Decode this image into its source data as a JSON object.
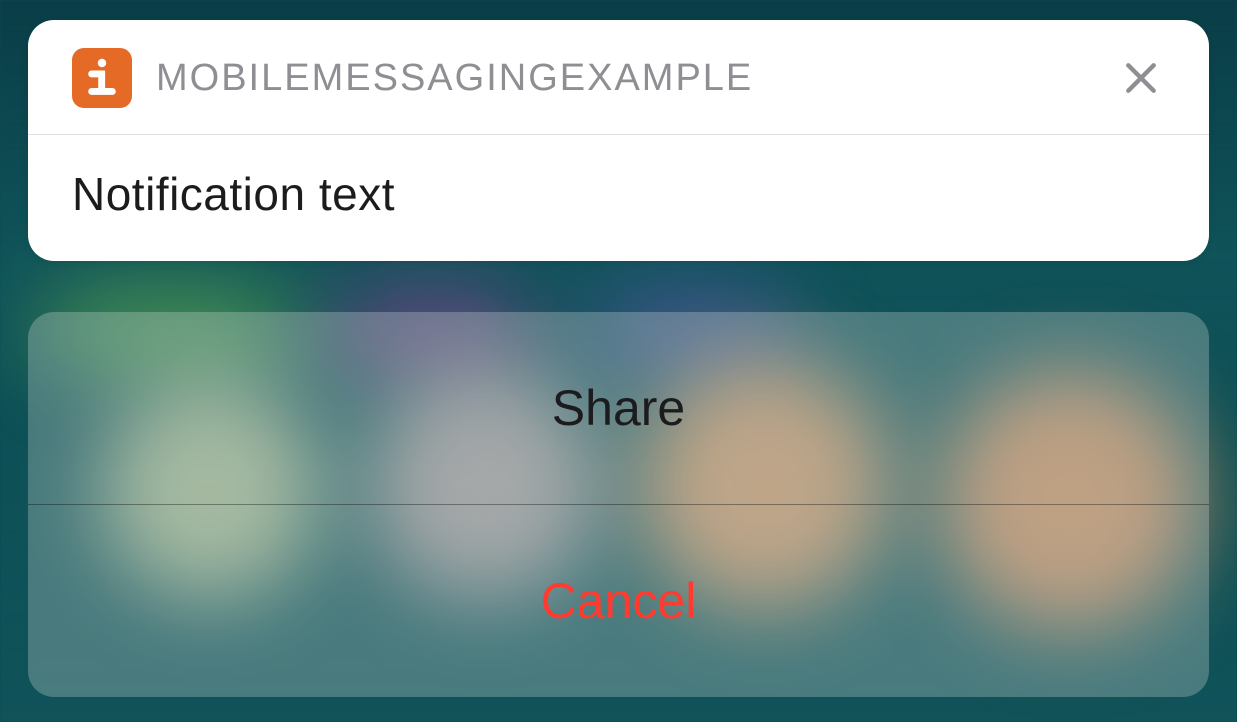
{
  "notification": {
    "app_name": "MOBILEMESSAGINGEXAMPLE",
    "body": "Notification text",
    "app_icon_glyph": "i",
    "app_icon_bg": "#e56a26"
  },
  "actions": {
    "primary_label": "Share",
    "cancel_label": "Cancel"
  }
}
